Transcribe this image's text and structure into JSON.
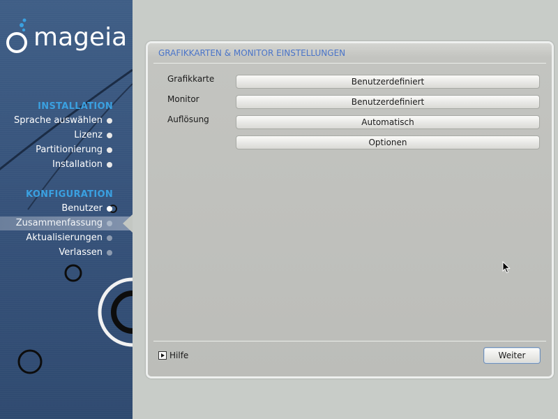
{
  "sidebar": {
    "logo_text": "mageia",
    "section_installation": "INSTALLATION",
    "section_configuration": "KONFIGURATION",
    "installation_items": [
      {
        "label": "Sprache auswählen"
      },
      {
        "label": "Lizenz"
      },
      {
        "label": "Partitionierung"
      },
      {
        "label": "Installation"
      }
    ],
    "configuration_items": [
      {
        "label": "Benutzer"
      },
      {
        "label": "Zusammenfassung"
      },
      {
        "label": "Aktualisierungen"
      },
      {
        "label": "Verlassen"
      }
    ]
  },
  "main": {
    "title": "GRAFIKKARTEN & MONITOR EINSTELLUNGEN",
    "fields": [
      {
        "label": "Grafikkarte",
        "value": "Benutzerdefiniert"
      },
      {
        "label": "Monitor",
        "value": "Benutzerdefiniert"
      },
      {
        "label": "Auflösung",
        "value": "Automatisch"
      },
      {
        "label": "",
        "value": "Optionen"
      }
    ],
    "help_label": "Hilfe",
    "next_label": "Weiter"
  },
  "colors": {
    "sidebar_bg": "#36527a",
    "section_title": "#3aa0e0",
    "panel_title": "#4a74c8",
    "panel_bg": "#bebfbb"
  }
}
